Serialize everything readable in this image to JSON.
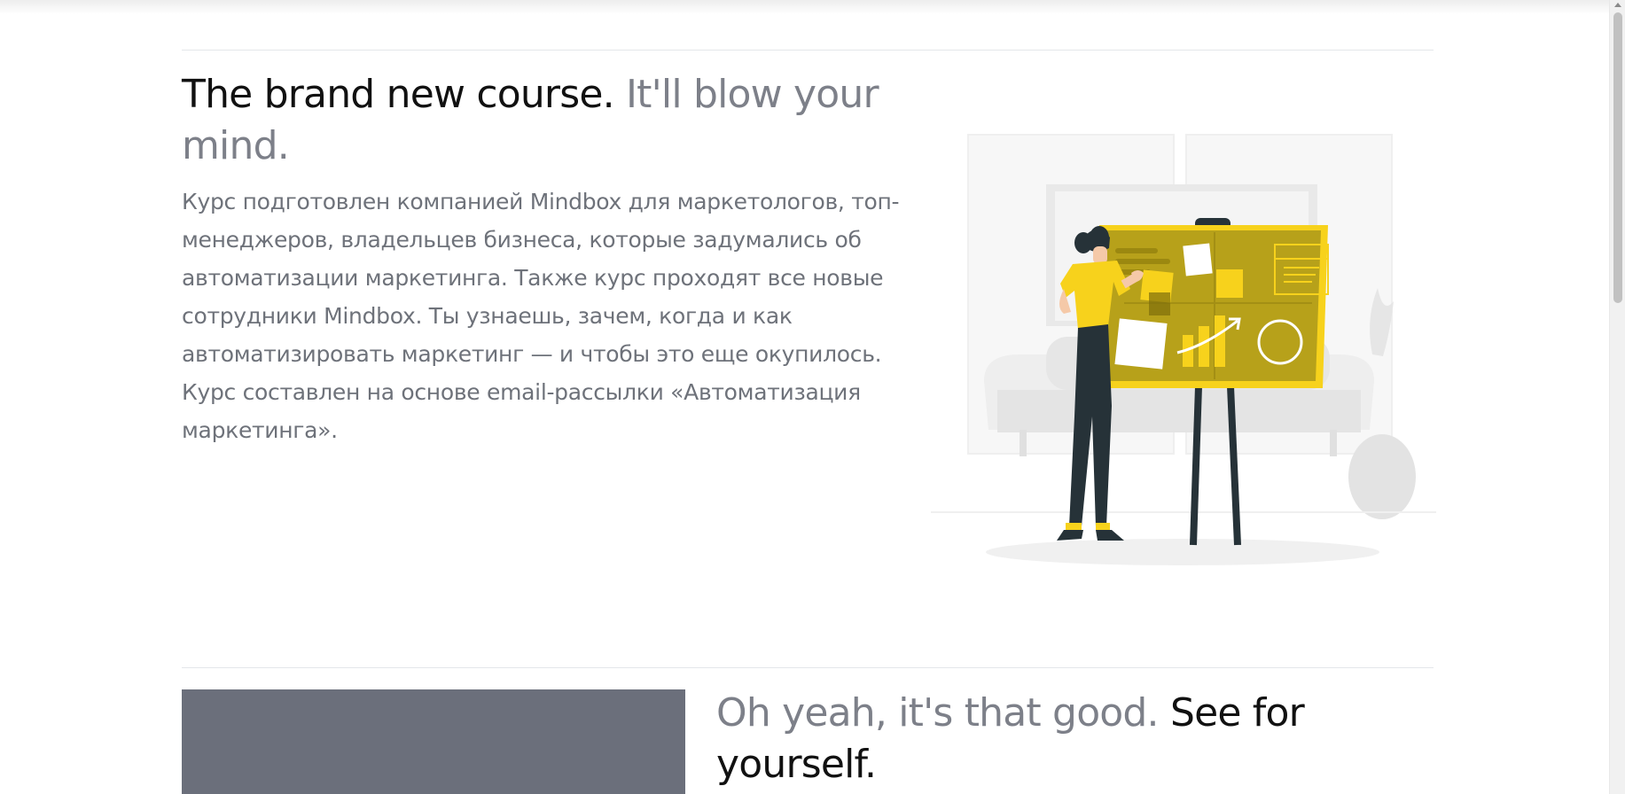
{
  "section1": {
    "heading_main": "The brand new course.",
    "heading_muted": "It'll blow your mind.",
    "description": "Курс подготовлен компанией Mindbox для маркетологов, топ-менеджеров, владельцев бизнеса, которые задумались об автоматизации маркетинга. Также курс проходят все новые сотрудники Mindbox. Ты узнаешь, зачем, когда и как автоматизировать маркетинг — и чтобы это еще окупилось. Курс составлен на основе email-рассылки «Автоматизация маркетинга».",
    "illustration": "person-at-whiteboard-illustration"
  },
  "section2": {
    "heading_muted": "Oh yeah, it's that good.",
    "heading_main": "See for yourself."
  },
  "colors": {
    "heading": "#111111",
    "muted_text": "#7d8089",
    "accent_yellow": "#f7d21c",
    "board_olive": "#b7a11a",
    "video_placeholder": "#6b6f7b",
    "divider": "#e4e6ea"
  }
}
